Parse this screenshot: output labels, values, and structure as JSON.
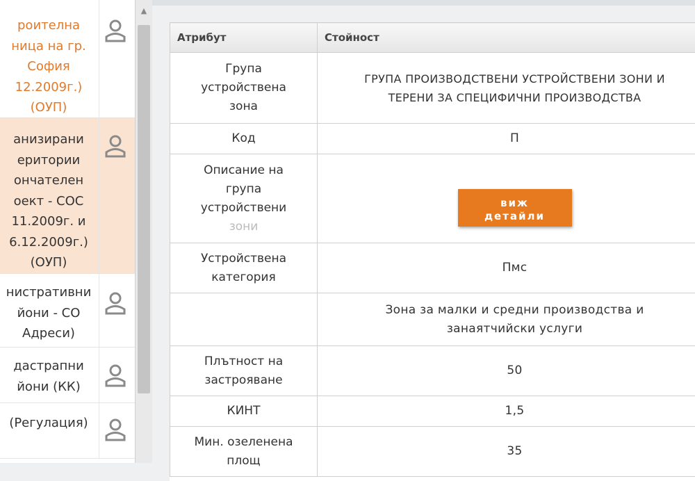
{
  "sidebar": {
    "layers": [
      {
        "label": "роителна\nница на гр.\nСофия\n12.2009г.)\n(ОУП)",
        "highlight": true,
        "selected": false
      },
      {
        "label": "анизирани\nеритории\nончателен\nоект - СОС\n11.2009г. и\n6.12.2009г.)\n(ОУП)",
        "highlight": false,
        "selected": true
      },
      {
        "label": "нистративни\nйони - СО\nАдреси)",
        "highlight": false,
        "selected": false
      },
      {
        "label": "дастрапни\nйони (КК)",
        "highlight": false,
        "selected": false
      },
      {
        "label": "(Регулация)",
        "highlight": false,
        "selected": false
      }
    ]
  },
  "table": {
    "col_attribute": "Атрибут",
    "col_value": "Стойност",
    "rows": [
      {
        "attribute": "Група\nустройствена\nзона",
        "value": "ГРУПА ПРОИЗВОДСТВЕНИ УСТРОЙСТВЕНИ ЗОНИ И\nТЕРЕНИ ЗА СПЕЦИФИЧНИ ПРОИЗВОДСТВА"
      },
      {
        "attribute": "Код",
        "value": "П"
      },
      {
        "attribute": "Описание на\nгрупа\nустройствени",
        "attribute_faint": "зони",
        "button": "виж\nдетайли"
      },
      {
        "attribute": "Устройствена\nкатегория",
        "value": "Пмс"
      },
      {
        "attribute": "",
        "value": "Зона за малки и средни производства и\nзанаятчийски услуги"
      },
      {
        "attribute": "Плътност на\nзастрояване",
        "value": "50"
      },
      {
        "attribute": "КИНТ",
        "value": "1,5"
      },
      {
        "attribute": "Мин. озеленена\nплощ",
        "value": "35"
      }
    ]
  },
  "colors": {
    "accent": "#e77a1e",
    "highlight_text": "#e07a2c",
    "selected_row": "#fbe3d2"
  }
}
